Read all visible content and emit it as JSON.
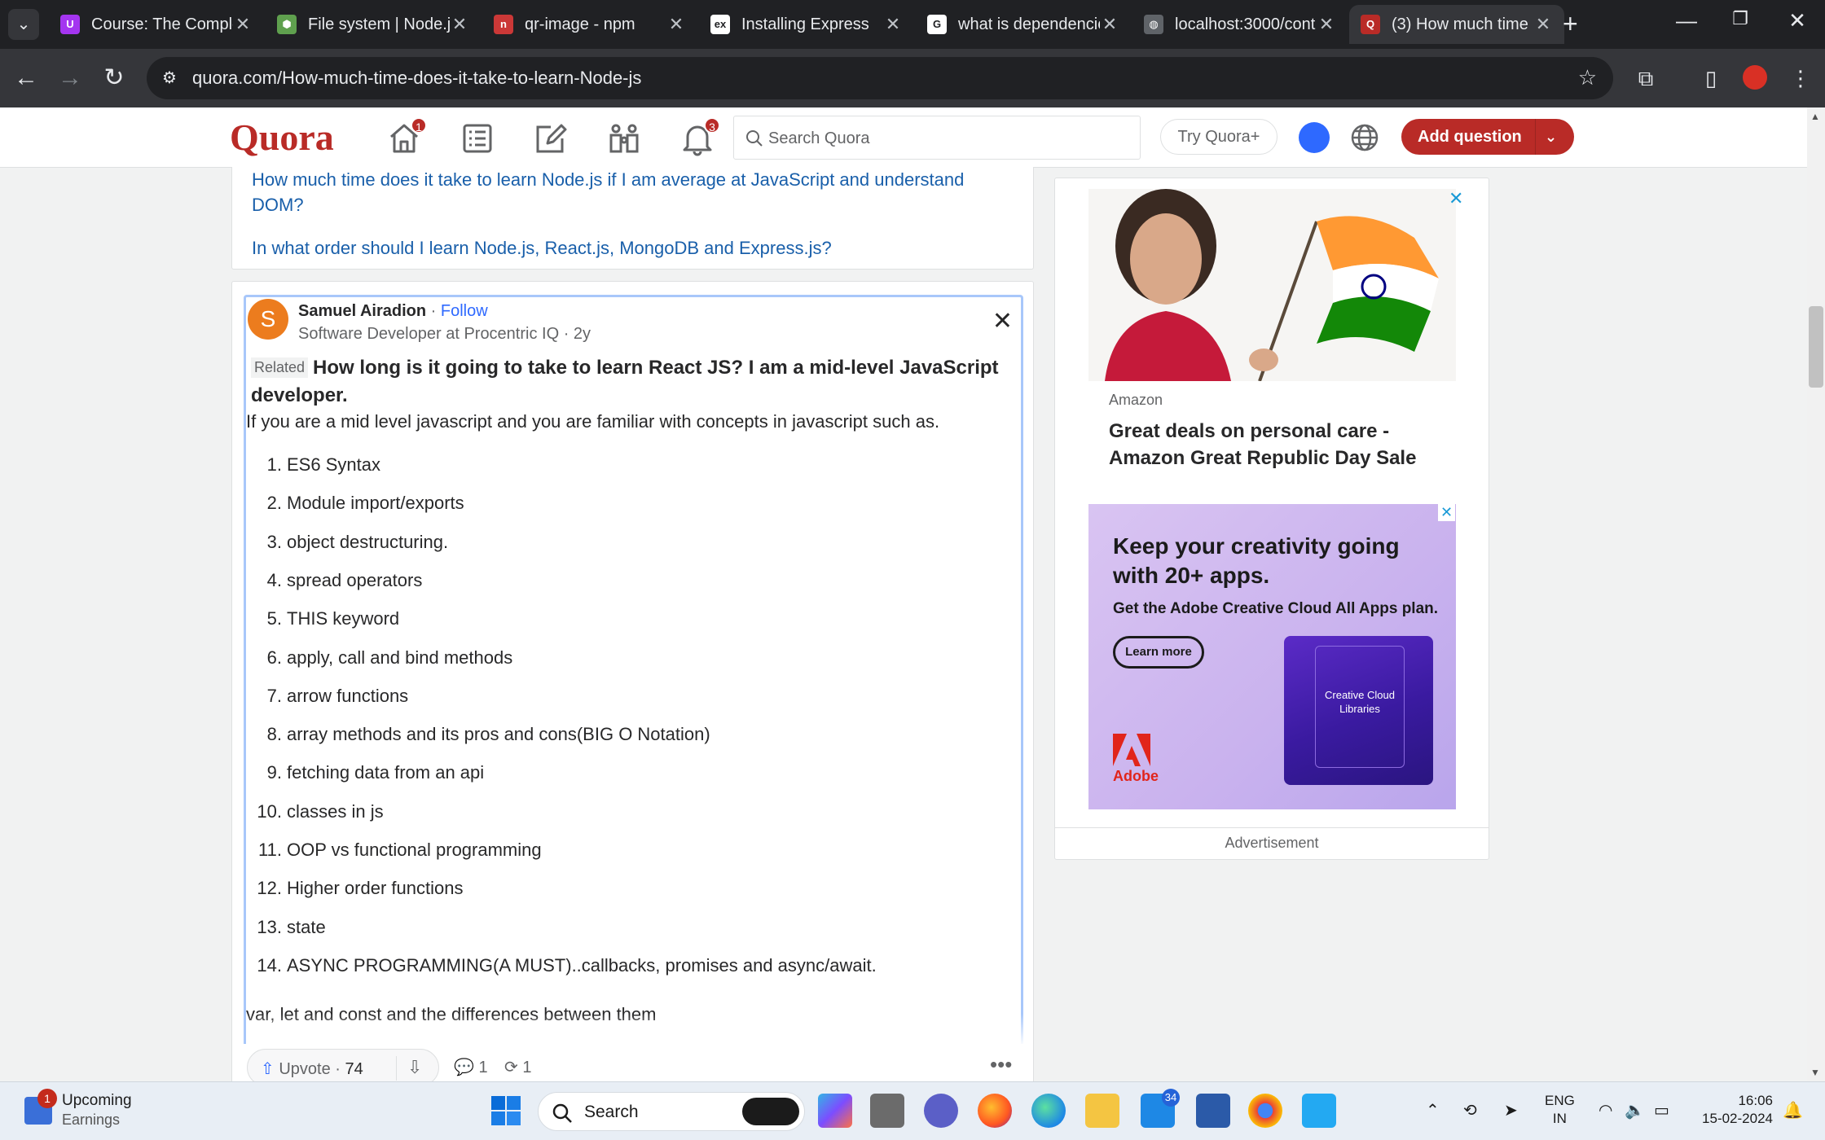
{
  "browser": {
    "tabs": [
      {
        "title": "Course: The Comple",
        "favicon_color": "#a435f0",
        "favicon_glyph": "U"
      },
      {
        "title": "File system | Node.js",
        "favicon_color": "#5fa04e",
        "favicon_glyph": "⬢"
      },
      {
        "title": "qr-image - npm",
        "favicon_color": "#cb3837",
        "favicon_glyph": "n"
      },
      {
        "title": "Installing Express",
        "favicon_color": "#ffffff",
        "favicon_glyph": "ex"
      },
      {
        "title": "what is dependencie",
        "favicon_color": "#ffffff",
        "favicon_glyph": "G"
      },
      {
        "title": "localhost:3000/cont",
        "favicon_color": "#5f6368",
        "favicon_glyph": "◍"
      },
      {
        "title": "(3) How much time",
        "favicon_color": "#b92b27",
        "favicon_glyph": "Q"
      }
    ],
    "active_tab_index": 6,
    "url": "quora.com/How-much-time-does-it-take-to-learn-Node-js"
  },
  "quora": {
    "logo": "Quora",
    "home_badge": "1",
    "notif_badge": "3",
    "search_placeholder": "Search Quora",
    "try_plus": "Try Quora+",
    "add_question": "Add question"
  },
  "related_questions": [
    "How much time does it take to learn Node.js if I am average at JavaScript and understand DOM?",
    "In what order should I learn Node.js, React.js, MongoDB and Express.js?"
  ],
  "answer": {
    "avatar_letter": "S",
    "author": "Samuel Airadion",
    "separator": " · ",
    "follow": "Follow",
    "credential": "Software Developer at Procentric IQ · 2y",
    "related_tag": "Related",
    "question": "How long is it going to take to learn React JS? I am a mid-level JavaScript developer.",
    "intro": "If you are a mid level javascript and you are familiar with concepts in javascript such as.",
    "list": [
      "ES6 Syntax",
      "Module import/exports",
      "object destructuring.",
      "spread operators",
      "THIS keyword",
      "apply, call and bind methods",
      "arrow functions",
      "array methods and its pros and cons(BIG O Notation)",
      "fetching data from an api",
      "classes in js",
      "OOP vs functional programming",
      "Higher order functions",
      "state",
      "ASYNC PROGRAMMING(A MUST)..callbacks, promises and async/await."
    ],
    "tail": "var, let and const and the differences between them",
    "upvote_label": "Upvote",
    "upvote_count": "74",
    "comments": "1",
    "shares": "1"
  },
  "ads": {
    "ad1_brand": "Amazon",
    "ad1_title": "Great deals on personal care - Amazon Great Republic Day Sale",
    "ad2_headline": "Keep your creativity going with 20+ apps.",
    "ad2_sub": "Get the Adobe Creative Cloud All Apps plan.",
    "ad2_button": "Learn more",
    "ad2_card": "Creative Cloud Libraries",
    "ad2_logo": "Adobe",
    "footer": "Advertisement"
  },
  "taskbar": {
    "weather_title": "Upcoming",
    "weather_sub": "Earnings",
    "weather_badge": "1",
    "search_label": "Search",
    "mail_badge": "34",
    "lang_line1": "ENG",
    "lang_line2": "IN",
    "time": "16:06",
    "date": "15-02-2024"
  }
}
